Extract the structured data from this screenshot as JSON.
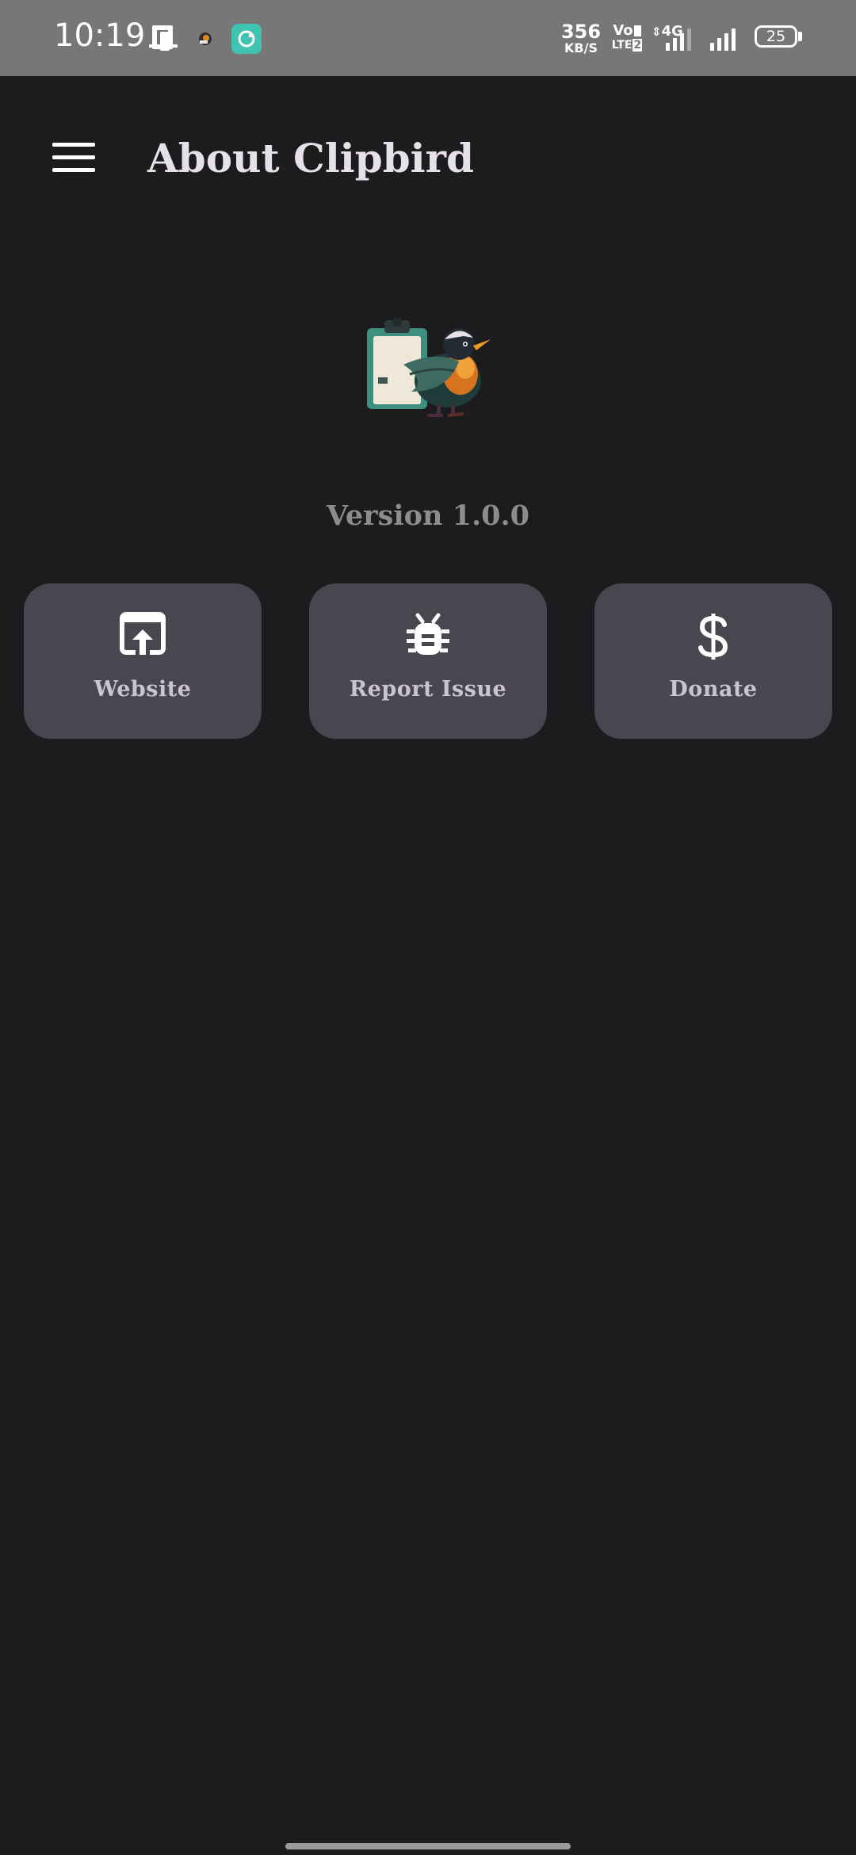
{
  "status_bar": {
    "time": "10:19",
    "network_speed_value": "356",
    "network_speed_unit": "KB/S",
    "volte_top": "Vo",
    "volte_bottom": "LTE",
    "sim_slot": "2",
    "network_type": "4G",
    "battery_level": "25",
    "icons": [
      "phone-notification-icon",
      "app-notification-icon",
      "chat-app-icon",
      "data-arrows-icon",
      "signal-icon",
      "signal-icon",
      "battery-icon"
    ]
  },
  "app_bar": {
    "title": "About Clipbird",
    "menu_icon": "hamburger-menu-icon"
  },
  "about": {
    "logo_icon": "clipbird-logo-icon",
    "version": "Version 1.0.0"
  },
  "actions": [
    {
      "label": "Website",
      "icon": "open-in-browser-icon"
    },
    {
      "label": "Report Issue",
      "icon": "bug-icon"
    },
    {
      "label": "Donate",
      "icon": "dollar-icon"
    }
  ],
  "colors": {
    "background": "#1c1b1d",
    "status_bar": "#777777",
    "card": "#48464e",
    "title_text": "#e6e1e6",
    "version_text": "#8e8b8f",
    "card_label": "#cac4cf"
  }
}
